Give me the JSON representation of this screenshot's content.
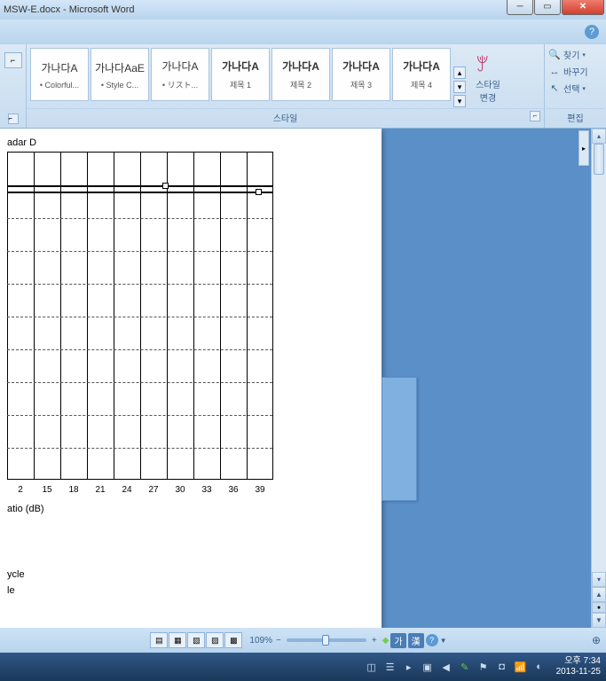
{
  "window": {
    "title": "MSW-E.docx - Microsoft Word"
  },
  "ribbon": {
    "styles": [
      {
        "preview": "가나다A",
        "label": "• Colorful...",
        "bold": false
      },
      {
        "preview": "가나다AaE",
        "label": "• Style C...",
        "bold": false
      },
      {
        "preview": "가나다A",
        "label": "• リスト...",
        "bold": false
      },
      {
        "preview": "가나다A",
        "label": "제목 1",
        "bold": true
      },
      {
        "preview": "가나다A",
        "label": "제목 2",
        "bold": true
      },
      {
        "preview": "가나다A",
        "label": "제목 3",
        "bold": true
      },
      {
        "preview": "가나다A",
        "label": "제목 4",
        "bold": true
      }
    ],
    "style_change_label": "스타일\n변경",
    "styles_group_label": "스타일",
    "editing": {
      "find": "찾기",
      "replace": "바꾸기",
      "select": "선택",
      "group_label": "편집"
    }
  },
  "document": {
    "chart_label": "adar D",
    "axis_label": "atio (dB)",
    "text1": "ycle",
    "text2": "le"
  },
  "chart_data": {
    "type": "line",
    "x_ticks": [
      "2",
      "15",
      "18",
      "21",
      "24",
      "27",
      "30",
      "33",
      "36",
      "39"
    ],
    "xlabel": "atio (dB)",
    "title": "adar D",
    "series": [
      {
        "y_position_fraction": 0.1
      },
      {
        "y_position_fraction": 0.12
      }
    ],
    "grid": {
      "vertical": 10,
      "horizontal_dashed": 9
    }
  },
  "statusbar": {
    "zoom": "109%",
    "ime_mode": "가",
    "ime_hanja": "漢"
  },
  "taskbar": {
    "time": "오후 7:34",
    "date": "2013-11-25"
  }
}
